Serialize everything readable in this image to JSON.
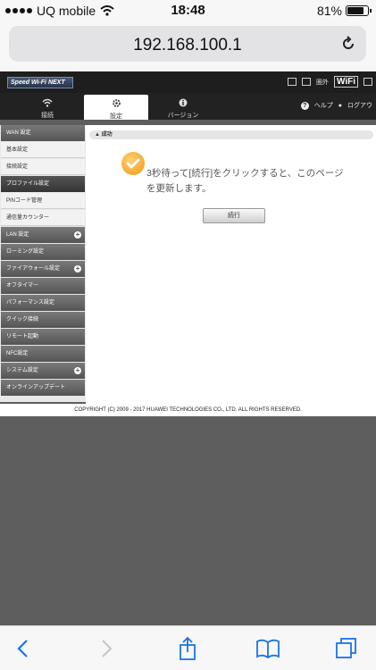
{
  "status_bar": {
    "carrier": "UQ mobile",
    "time": "18:48",
    "battery": "81%",
    "battery_level": 0.81
  },
  "browser": {
    "url": "192.168.100.1"
  },
  "router": {
    "brand": "Speed Wi-Fi NEXT",
    "header_icons": {
      "label_small": "圏外",
      "wifi_badge": "WiFi"
    },
    "tabs": [
      {
        "label": "接続",
        "icon": "wifi-icon"
      },
      {
        "label": "設定",
        "icon": "gear-icon"
      },
      {
        "label": "バージョン",
        "icon": "info-icon"
      }
    ],
    "help_label": "ヘルプ",
    "logout_label": "ログアウ"
  },
  "sidebar": {
    "items": [
      {
        "label": "WAN 設定",
        "type": "group"
      },
      {
        "label": "基本設定",
        "type": "sub"
      },
      {
        "label": "接続設定",
        "type": "sub"
      },
      {
        "label": "プロファイル設定",
        "type": "active"
      },
      {
        "label": "PINコード管理",
        "type": "sub"
      },
      {
        "label": "通信量カウンター",
        "type": "sub"
      },
      {
        "label": "LAN 設定",
        "type": "group",
        "expand": true
      },
      {
        "label": "ローミング設定",
        "type": "group"
      },
      {
        "label": "ファイアウォール設定",
        "type": "group",
        "expand": true
      },
      {
        "label": "オフタイマー",
        "type": "group"
      },
      {
        "label": "パフォーマンス設定",
        "type": "group"
      },
      {
        "label": "クイック接続",
        "type": "group"
      },
      {
        "label": "リモート起動",
        "type": "group"
      },
      {
        "label": "NFC設定",
        "type": "group"
      },
      {
        "label": "システム設定",
        "type": "group",
        "expand": true
      },
      {
        "label": "オンラインアップデート",
        "type": "group"
      }
    ]
  },
  "main": {
    "section_title": "成功",
    "message_line1": "3秒待って[続行]をクリックすると、このページ",
    "message_line2": "を更新します。",
    "continue_label": "続行"
  },
  "footer": {
    "copyright": "COPYRIGHT (C) 2009 - 2017 HUAWEI TECHNOLOGIES CO., LTD. ALL RIGHTS RESERVED."
  },
  "colors": {
    "accent_check": "#f0a020",
    "header_bg": "#1e1e1e"
  }
}
